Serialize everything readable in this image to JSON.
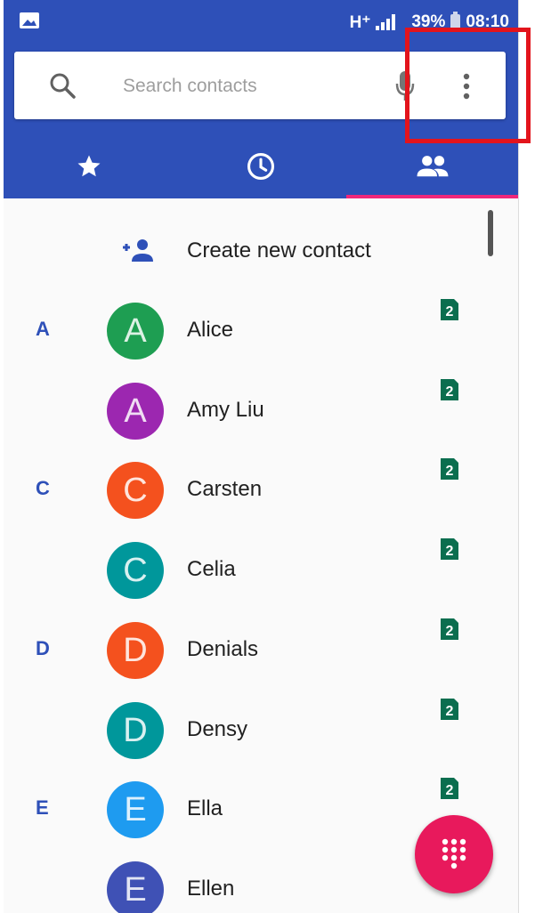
{
  "status_bar": {
    "network": "H⁺",
    "battery": "39%",
    "time": "08:10",
    "icons": [
      "image-icon",
      "signal-icon",
      "battery-icon"
    ]
  },
  "search": {
    "placeholder": "Search contacts",
    "icons": [
      "search-icon",
      "mic-icon",
      "more-options-icon"
    ]
  },
  "tabs": [
    {
      "name": "favorites",
      "icon": "star-icon",
      "active": false
    },
    {
      "name": "recents",
      "icon": "clock-icon",
      "active": false
    },
    {
      "name": "contacts",
      "icon": "people-icon",
      "active": true
    }
  ],
  "create_contact": {
    "label": "Create new contact",
    "icon": "add-person-icon"
  },
  "contacts": [
    {
      "letter": "A",
      "initial": "A",
      "name": "Alice",
      "color": "#1e9e52"
    },
    {
      "letter": "",
      "initial": "A",
      "name": "Amy Liu",
      "color": "#9c27b0"
    },
    {
      "letter": "C",
      "initial": "C",
      "name": "Carsten",
      "color": "#f4511e"
    },
    {
      "letter": "",
      "initial": "C",
      "name": "Celia",
      "color": "#00979b"
    },
    {
      "letter": "D",
      "initial": "D",
      "name": "Denials",
      "color": "#f4511e"
    },
    {
      "letter": "",
      "initial": "D",
      "name": "Densy",
      "color": "#00979b"
    },
    {
      "letter": "E",
      "initial": "E",
      "name": "Ella",
      "color": "#1e9bf0"
    },
    {
      "letter": "",
      "initial": "E",
      "name": "Ellen",
      "color": "#3f51b5"
    }
  ],
  "sim_badge": "2",
  "colors": {
    "accent": "#2e50b8",
    "tab_indicator": "#f0277a",
    "fab": "#e8195c",
    "sim": "#0b6e4f",
    "highlight": "#e3141c"
  }
}
